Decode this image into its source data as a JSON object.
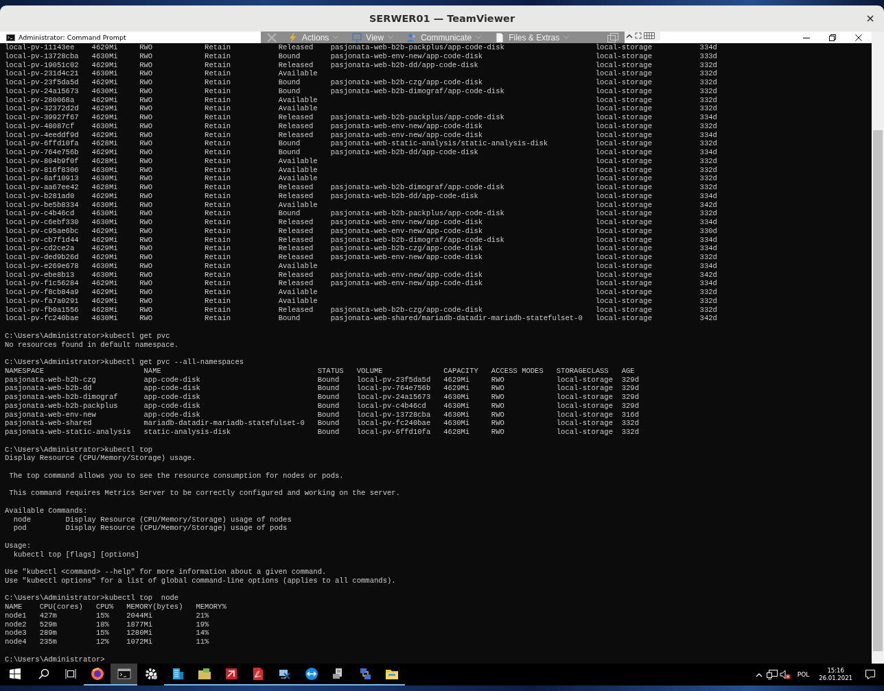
{
  "window": {
    "title": "SERWER01 — TeamViewer"
  },
  "remote_toolbar": {
    "menus": [
      "Actions",
      "View",
      "Communicate",
      "Files & Extras"
    ]
  },
  "console_window": {
    "title": "Administrator: Command Prompt"
  },
  "console": {
    "items": [
      {
        "kind": "table",
        "rows": [
          {
            "column_1": "local-pv-11143ee",
            "column_2": "4629Mi",
            "column_3": "RWO",
            "column_4": "Retain",
            "column_5": "Released",
            "column_6": "pasjonata-web-b2b-packplus/app-code-disk",
            "column_7": "local-storage",
            "column_8": "334d"
          },
          {
            "column_1": "local-pv-13728cba",
            "column_2": "4630Mi",
            "column_3": "RWO",
            "column_4": "Retain",
            "column_5": "Bound",
            "column_6": "pasjonata-web-env-new/app-code-disk",
            "column_7": "local-storage",
            "column_8": "333d"
          },
          {
            "column_1": "local-pv-19051c02",
            "column_2": "4629Mi",
            "column_3": "RWO",
            "column_4": "Retain",
            "column_5": "Released",
            "column_6": "pasjonata-web-b2b-dd/app-code-disk",
            "column_7": "local-storage",
            "column_8": "332d"
          },
          {
            "column_1": "local-pv-231d4c21",
            "column_2": "4630Mi",
            "column_3": "RWO",
            "column_4": "Retain",
            "column_5": "Available",
            "column_7": "local-storage",
            "column_8": "332d"
          },
          {
            "column_1": "local-pv-23f5da5d",
            "column_2": "4629Mi",
            "column_3": "RWO",
            "column_4": "Retain",
            "column_5": "Bound",
            "column_6": "pasjonata-web-b2b-czg/app-code-disk",
            "column_7": "local-storage",
            "column_8": "332d"
          },
          {
            "column_1": "local-pv-24a15673",
            "column_2": "4630Mi",
            "column_3": "RWO",
            "column_4": "Retain",
            "column_5": "Bound",
            "column_6": "pasjonata-web-b2b-dimograf/app-code-disk",
            "column_7": "local-storage",
            "column_8": "332d"
          },
          {
            "column_1": "local-pv-280068a",
            "column_2": "4629Mi",
            "column_3": "RWO",
            "column_4": "Retain",
            "column_5": "Available",
            "column_7": "local-storage",
            "column_8": "332d"
          },
          {
            "column_1": "local-pv-32372d2d",
            "column_2": "4629Mi",
            "column_3": "RWO",
            "column_4": "Retain",
            "column_5": "Available",
            "column_7": "local-storage",
            "column_8": "332d"
          },
          {
            "column_1": "local-pv-39927f67",
            "column_2": "4629Mi",
            "column_3": "RWO",
            "column_4": "Retain",
            "column_5": "Released",
            "column_6": "pasjonata-web-b2b-packplus/app-code-disk",
            "column_7": "local-storage",
            "column_8": "334d"
          },
          {
            "column_1": "local-pv-48087cf",
            "column_2": "4630Mi",
            "column_3": "RWO",
            "column_4": "Retain",
            "column_5": "Released",
            "column_6": "pasjonata-web-env-new/app-code-disk",
            "column_7": "local-storage",
            "column_8": "332d"
          },
          {
            "column_1": "local-pv-4eeddf9d",
            "column_2": "4629Mi",
            "column_3": "RWO",
            "column_4": "Retain",
            "column_5": "Released",
            "column_6": "pasjonata-web-env-new/app-code-disk",
            "column_7": "local-storage",
            "column_8": "334d"
          },
          {
            "column_1": "local-pv-6ffd10fa",
            "column_2": "4628Mi",
            "column_3": "RWO",
            "column_4": "Retain",
            "column_5": "Bound",
            "column_6": "pasjonata-web-static-analysis/static-analysis-disk",
            "column_7": "local-storage",
            "column_8": "332d"
          },
          {
            "column_1": "local-pv-764e756b",
            "column_2": "4629Mi",
            "column_3": "RWO",
            "column_4": "Retain",
            "column_5": "Bound",
            "column_6": "pasjonata-web-b2b-dd/app-code-disk",
            "column_7": "local-storage",
            "column_8": "334d"
          },
          {
            "column_1": "local-pv-804b9f0f",
            "column_2": "4628Mi",
            "column_3": "RWO",
            "column_4": "Retain",
            "column_5": "Available",
            "column_7": "local-storage",
            "column_8": "332d"
          },
          {
            "column_1": "local-pv-816f8306",
            "column_2": "4630Mi",
            "column_3": "RWO",
            "column_4": "Retain",
            "column_5": "Available",
            "column_7": "local-storage",
            "column_8": "332d"
          },
          {
            "column_1": "local-pv-8af10913",
            "column_2": "4630Mi",
            "column_3": "RWO",
            "column_4": "Retain",
            "column_5": "Available",
            "column_7": "local-storage",
            "column_8": "332d"
          },
          {
            "column_1": "local-pv-aa67ee42",
            "column_2": "4628Mi",
            "column_3": "RWO",
            "column_4": "Retain",
            "column_5": "Released",
            "column_6": "pasjonata-web-b2b-dimograf/app-code-disk",
            "column_7": "local-storage",
            "column_8": "332d"
          },
          {
            "column_1": "local-pv-b281ad0",
            "column_2": "4629Mi",
            "column_3": "RWO",
            "column_4": "Retain",
            "column_5": "Released",
            "column_6": "pasjonata-web-b2b-dd/app-code-disk",
            "column_7": "local-storage",
            "column_8": "334d"
          },
          {
            "column_1": "local-pv-be5b8334",
            "column_2": "4630Mi",
            "column_3": "RWO",
            "column_4": "Retain",
            "column_5": "Available",
            "column_7": "local-storage",
            "column_8": "342d"
          },
          {
            "column_1": "local-pv-c4b46cd",
            "column_2": "4630Mi",
            "column_3": "RWO",
            "column_4": "Retain",
            "column_5": "Bound",
            "column_6": "pasjonata-web-b2b-packplus/app-code-disk",
            "column_7": "local-storage",
            "column_8": "332d"
          },
          {
            "column_1": "local-pv-c6ebf330",
            "column_2": "4630Mi",
            "column_3": "RWO",
            "column_4": "Retain",
            "column_5": "Released",
            "column_6": "pasjonata-web-env-new/app-code-disk",
            "column_7": "local-storage",
            "column_8": "334d"
          },
          {
            "column_1": "local-pv-c95ae6bc",
            "column_2": "4629Mi",
            "column_3": "RWO",
            "column_4": "Retain",
            "column_5": "Released",
            "column_6": "pasjonata-web-env-new/app-code-disk",
            "column_7": "local-storage",
            "column_8": "330d"
          },
          {
            "column_1": "local-pv-cb7f1d44",
            "column_2": "4629Mi",
            "column_3": "RWO",
            "column_4": "Retain",
            "column_5": "Released",
            "column_6": "pasjonata-web-b2b-dimograf/app-code-disk",
            "column_7": "local-storage",
            "column_8": "334d"
          },
          {
            "column_1": "local-pv-cd2ce2a",
            "column_2": "4629Mi",
            "column_3": "RWO",
            "column_4": "Retain",
            "column_5": "Released",
            "column_6": "pasjonata-web-b2b-czg/app-code-disk",
            "column_7": "local-storage",
            "column_8": "334d"
          },
          {
            "column_1": "local-pv-ded9b26d",
            "column_2": "4629Mi",
            "column_3": "RWO",
            "column_4": "Retain",
            "column_5": "Released",
            "column_6": "pasjonata-web-env-new/app-code-disk",
            "column_7": "local-storage",
            "column_8": "332d"
          },
          {
            "column_1": "local-pv-e269e678",
            "column_2": "4630Mi",
            "column_3": "RWO",
            "column_4": "Retain",
            "column_5": "Available",
            "column_7": "local-storage",
            "column_8": "334d"
          },
          {
            "column_1": "local-pv-ebe8b13",
            "column_2": "4630Mi",
            "column_3": "RWO",
            "column_4": "Retain",
            "column_5": "Released",
            "column_6": "pasjonata-web-env-new/app-code-disk",
            "column_7": "local-storage",
            "column_8": "342d"
          },
          {
            "column_1": "local-pv-f1c56284",
            "column_2": "4629Mi",
            "column_3": "RWO",
            "column_4": "Retain",
            "column_5": "Released",
            "column_6": "pasjonata-web-env-new/app-code-disk",
            "column_7": "local-storage",
            "column_8": "334d"
          },
          {
            "column_1": "local-pv-f8cb84a9",
            "column_2": "4629Mi",
            "column_3": "RWO",
            "column_4": "Retain",
            "column_5": "Available",
            "column_7": "local-storage",
            "column_8": "332d"
          },
          {
            "column_1": "local-pv-fa7a0291",
            "column_2": "4629Mi",
            "column_3": "RWO",
            "column_4": "Retain",
            "column_5": "Available",
            "column_7": "local-storage",
            "column_8": "332d"
          },
          {
            "column_1": "local-pv-fb0a1556",
            "column_2": "4628Mi",
            "column_3": "RWO",
            "column_4": "Retain",
            "column_5": "Released",
            "column_6": "pasjonata-web-b2b-czg/app-code-disk",
            "column_7": "local-storage",
            "column_8": "332d"
          },
          {
            "column_1": "local-pv-fc240bae",
            "column_2": "4630Mi",
            "column_3": "RWO",
            "column_4": "Retain",
            "column_5": "Bound",
            "column_6": "pasjonata-web-shared/mariadb-datadir-mariadb-statefulset-0",
            "column_7": "local-storage",
            "column_8": "342d"
          }
        ]
      },
      {
        "kind": "blank"
      },
      {
        "kind": "text",
        "text": "C:\\Users\\Administrator>kubectl get pvc"
      },
      {
        "kind": "text",
        "text": "No resources found in default namespace."
      },
      {
        "kind": "blank"
      },
      {
        "kind": "text",
        "text": "C:\\Users\\Administrator>kubectl get pvc --all-namespaces"
      },
      {
        "kind": "table",
        "header": [
          "NAMESPACE",
          "NAME",
          "STATUS",
          "VOLUME",
          "CAPACITY",
          "ACCESS MODES",
          "STORAGECLASS",
          "AGE"
        ],
        "rows": [
          [
            "pasjonata-web-b2b-czg",
            "app-code-disk",
            "Bound",
            "local-pv-23f5da5d",
            "4629Mi",
            "RWO",
            "local-storage",
            "329d"
          ],
          [
            "pasjonata-web-b2b-dd",
            "app-code-disk",
            "Bound",
            "local-pv-764e756b",
            "4629Mi",
            "RWO",
            "local-storage",
            "329d"
          ],
          [
            "pasjonata-web-b2b-dimograf",
            "app-code-disk",
            "Bound",
            "local-pv-24a15673",
            "4630Mi",
            "RWO",
            "local-storage",
            "329d"
          ],
          [
            "pasjonata-web-b2b-packplus",
            "app-code-disk",
            "Bound",
            "local-pv-c4b46cd",
            "4630Mi",
            "RWO",
            "local-storage",
            "329d"
          ],
          [
            "pasjonata-web-env-new",
            "app-code-disk",
            "Bound",
            "local-pv-13728cba",
            "4630Mi",
            "RWO",
            "local-storage",
            "316d"
          ],
          [
            "pasjonata-web-shared",
            "mariadb-datadir-mariadb-statefulset-0",
            "Bound",
            "local-pv-fc240bae",
            "4630Mi",
            "RWO",
            "local-storage",
            "332d"
          ],
          [
            "pasjonata-web-static-analysis",
            "static-analysis-disk",
            "Bound",
            "local-pv-6ffd10fa",
            "4628Mi",
            "RWO",
            "local-storage",
            "332d"
          ]
        ]
      },
      {
        "kind": "blank"
      },
      {
        "kind": "text",
        "text": "C:\\Users\\Administrator>kubectl top"
      },
      {
        "kind": "text",
        "text": "Display Resource (CPU/Memory/Storage) usage."
      },
      {
        "kind": "blank"
      },
      {
        "kind": "text",
        "text": " The top command allows you to see the resource consumption for nodes or pods."
      },
      {
        "kind": "blank"
      },
      {
        "kind": "text",
        "text": " This command requires Metrics Server to be correctly configured and working on the server."
      },
      {
        "kind": "blank"
      },
      {
        "kind": "text",
        "text": "Available Commands:"
      },
      {
        "kind": "text",
        "text": "  node        Display Resource (CPU/Memory/Storage) usage of nodes"
      },
      {
        "kind": "text",
        "text": "  pod         Display Resource (CPU/Memory/Storage) usage of pods"
      },
      {
        "kind": "blank"
      },
      {
        "kind": "text",
        "text": "Usage:"
      },
      {
        "kind": "text",
        "text": "  kubectl top [flags] [options]"
      },
      {
        "kind": "blank"
      },
      {
        "kind": "text",
        "text": "Use \"kubectl <command> --help\" for more information about a given command."
      },
      {
        "kind": "text",
        "text": "Use \"kubectl options\" for a list of global command-line options (applies to all commands)."
      },
      {
        "kind": "blank"
      },
      {
        "kind": "text",
        "text": "C:\\Users\\Administrator>kubectl top  node"
      },
      {
        "kind": "table",
        "header": [
          "NAME",
          "CPU(cores)",
          "CPU%",
          "MEMORY(bytes)",
          "MEMORY%"
        ],
        "rows": [
          [
            "node1",
            "427m",
            "15%",
            "2044Mi",
            "21%"
          ],
          [
            "node2",
            "529m",
            "18%",
            "1877Mi",
            "19%"
          ],
          [
            "node3",
            "289m",
            "15%",
            "1280Mi",
            "14%"
          ],
          [
            "node4",
            "235m",
            "12%",
            "1072Mi",
            "11%"
          ]
        ]
      },
      {
        "kind": "blank"
      },
      {
        "kind": "text",
        "text": "C:\\Users\\Administrator>"
      }
    ]
  },
  "taskbar": {
    "apps": [
      {
        "running": true,
        "selected": false
      },
      {
        "running": true,
        "selected": true
      },
      {
        "running": false,
        "selected": false
      },
      {
        "running": true,
        "selected": false
      },
      {
        "running": true,
        "selected": false
      },
      {
        "running": true,
        "selected": false
      },
      {
        "running": true,
        "selected": false
      },
      {
        "running": true,
        "selected": false
      },
      {
        "running": true,
        "selected": false
      },
      {
        "running": true,
        "selected": false
      },
      {
        "running": true,
        "selected": false
      },
      {
        "running": true,
        "selected": false
      }
    ],
    "volume_muted": true,
    "language": "POL",
    "time": "15:16",
    "date": "26.01.2021"
  }
}
